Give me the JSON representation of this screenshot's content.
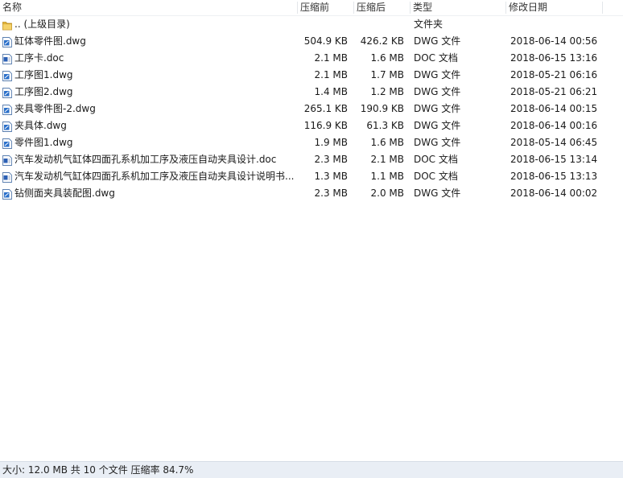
{
  "header": {
    "name": "名称",
    "before": "压缩前",
    "after": "压缩后",
    "type": "类型",
    "date": "修改日期"
  },
  "files": [
    {
      "icon": "folder-icon",
      "name": ".. (上级目录)",
      "before": "",
      "after": "",
      "type": "文件夹",
      "date": ""
    },
    {
      "icon": "dwg-file-icon",
      "name": "缸体零件图.dwg",
      "before": "504.9 KB",
      "after": "426.2 KB",
      "type": "DWG 文件",
      "date": "2018-06-14 00:56"
    },
    {
      "icon": "doc-file-icon",
      "name": "工序卡.doc",
      "before": "2.1 MB",
      "after": "1.6 MB",
      "type": "DOC 文档",
      "date": "2018-06-15 13:16"
    },
    {
      "icon": "dwg-file-icon",
      "name": "工序图1.dwg",
      "before": "2.1 MB",
      "after": "1.7 MB",
      "type": "DWG 文件",
      "date": "2018-05-21 06:16"
    },
    {
      "icon": "dwg-file-icon",
      "name": "工序图2.dwg",
      "before": "1.4 MB",
      "after": "1.2 MB",
      "type": "DWG 文件",
      "date": "2018-05-21 06:21"
    },
    {
      "icon": "dwg-file-icon",
      "name": "夹具零件图-2.dwg",
      "before": "265.1 KB",
      "after": "190.9 KB",
      "type": "DWG 文件",
      "date": "2018-06-14 00:15"
    },
    {
      "icon": "dwg-file-icon",
      "name": "夹具体.dwg",
      "before": "116.9 KB",
      "after": "61.3 KB",
      "type": "DWG 文件",
      "date": "2018-06-14 00:16"
    },
    {
      "icon": "dwg-file-icon",
      "name": "零件图1.dwg",
      "before": "1.9 MB",
      "after": "1.6 MB",
      "type": "DWG 文件",
      "date": "2018-05-14 06:45"
    },
    {
      "icon": "doc-file-icon",
      "name": "汽车发动机气缸体四面孔系机加工序及液压自动夹具设计.doc",
      "before": "2.3 MB",
      "after": "2.1 MB",
      "type": "DOC 文档",
      "date": "2018-06-15 13:14"
    },
    {
      "icon": "doc-file-icon",
      "name": "汽车发动机气缸体四面孔系机加工序及液压自动夹具设计说明书...",
      "before": "1.3 MB",
      "after": "1.1 MB",
      "type": "DOC 文档",
      "date": "2018-06-15 13:13"
    },
    {
      "icon": "dwg-file-icon",
      "name": "钻侧面夹具装配图.dwg",
      "before": "2.3 MB",
      "after": "2.0 MB",
      "type": "DWG 文件",
      "date": "2018-06-14 00:02"
    }
  ],
  "status": {
    "text": "大小: 12.0 MB 共 10 个文件 压缩率 84.7%"
  }
}
